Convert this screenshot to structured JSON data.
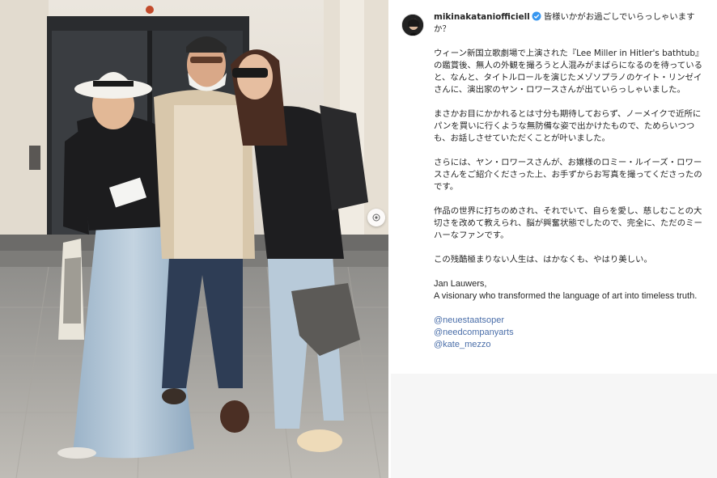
{
  "post": {
    "username": "mikinakataniofficiell",
    "verified_icon": "verified-badge-icon",
    "caption_opening": "皆様いかがお過ごしでいらっしゃいますか？",
    "paragraphs": [
      "ウィーン新国立歌劇場で上演された『Lee Miller in Hitler's bathtub』の鑑賞後、無人の外観を撮ろうと人混みがまばらになるのを待っていると、なんと、タイトルロールを演じたメゾソプラノのケイト・リンゼイさんに、演出家のヤン・ロワースさんが出ていらっしゃいました。",
      "まさかお目にかかれるとは寸分も期待しておらず、ノーメイクで近所にパンを買いに行くような無防備な姿で出かけたもので、ためらいつつも、お話しさせていただくことが叶いました。",
      "さらには、ヤン・ロワースさんが、お嬢様のロミー・ルイーズ・ロワースさんをご紹介くださった上、お手ずからお写真を撮ってくださったのです。",
      "作品の世界に打ちのめされ、それでいて、自らを愛し、慈しむことの大切さを改めて教えられ、脳が興奮状態でしたので、完全に、ただのミーハーなファンです。",
      "この残酷極まりない人生は、はかなくも、やはり美しい。"
    ],
    "english_name": "Jan Lauwers,",
    "english_line": "A visionary who transformed the language of art into timeless truth.",
    "tags": [
      "@neuestaatsoper",
      "@needcompanyarts",
      "@kate_mezzo"
    ]
  },
  "colors": {
    "link": "#4a6ea9",
    "verified": "#3897f0",
    "text": "#262626"
  },
  "icons": {
    "carousel_next": "chevron-right-icon"
  }
}
